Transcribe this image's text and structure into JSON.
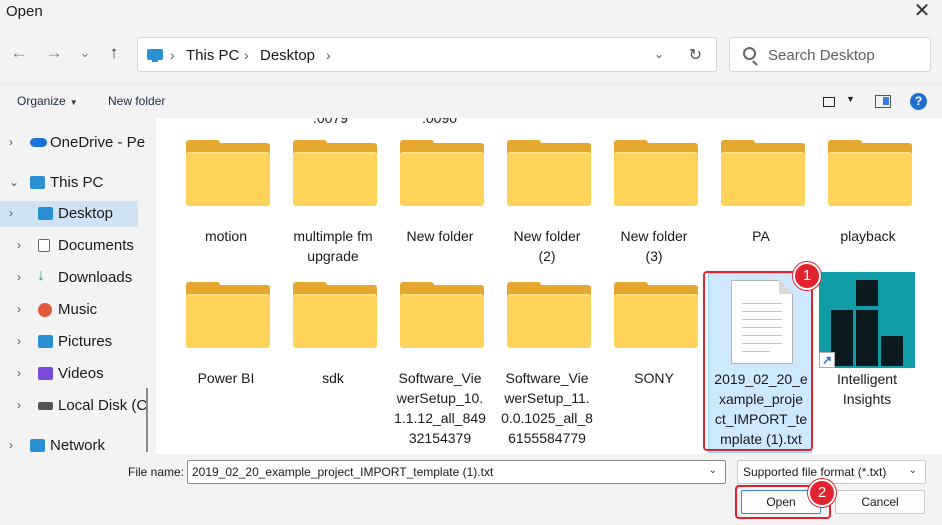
{
  "window": {
    "title": "Open"
  },
  "nav_buttons": {
    "back": "←",
    "forward": "→",
    "recent": "⌄",
    "up": "↑"
  },
  "address": {
    "crumbs": [
      "This PC",
      "Desktop"
    ],
    "separator": "›"
  },
  "search": {
    "placeholder": "Search Desktop"
  },
  "toolbar": {
    "organize": "Organize",
    "new_folder": "New folder"
  },
  "sidebar": {
    "items": [
      {
        "label": "OneDrive - Pe",
        "icon": "cloud-icon",
        "color": "#1a73d9"
      },
      {
        "label": "This PC",
        "icon": "computer-icon",
        "color": "#2b8fd4"
      },
      {
        "label": "Desktop",
        "icon": "desktop-icon",
        "color": "#2b8fd4",
        "selected": true
      },
      {
        "label": "Documents",
        "icon": "document-icon",
        "color": "#6a6a6a"
      },
      {
        "label": "Downloads",
        "icon": "download-icon",
        "color": "#1b9e5a"
      },
      {
        "label": "Music",
        "icon": "music-icon",
        "color": "#e05a3a"
      },
      {
        "label": "Pictures",
        "icon": "pictures-icon",
        "color": "#2b8fd4"
      },
      {
        "label": "Videos",
        "icon": "videos-icon",
        "color": "#7a4ad9"
      },
      {
        "label": "Local Disk (C",
        "icon": "disk-icon",
        "color": "#555555"
      },
      {
        "label": "Network",
        "icon": "network-icon",
        "color": "#2b8fd4"
      }
    ]
  },
  "files": {
    "partial_above": [
      ".0079",
      ".0090"
    ],
    "row1": [
      {
        "name": [
          "motion"
        ]
      },
      {
        "name": [
          "multimple fm",
          "upgrade"
        ]
      },
      {
        "name": [
          "New folder"
        ]
      },
      {
        "name": [
          "New folder",
          "(2)"
        ]
      },
      {
        "name": [
          "New folder",
          "(3)"
        ]
      },
      {
        "name": [
          "PA"
        ]
      },
      {
        "name": [
          "playback"
        ]
      }
    ],
    "row2": [
      {
        "name": [
          "Power BI"
        ]
      },
      {
        "name": [
          "sdk"
        ]
      },
      {
        "name": [
          "Software_Vie",
          "werSetup_10.",
          "1.1.12_all_849",
          "32154379"
        ]
      },
      {
        "name": [
          "Software_Vie",
          "werSetup_11.",
          "0.0.1025_all_8",
          "6155584779"
        ]
      },
      {
        "name": [
          "SONY"
        ]
      }
    ],
    "selected_file": {
      "name": [
        "2019_02_20_e",
        "xample_proje",
        "ct_IMPORT_te",
        "mplate (1).txt"
      ]
    },
    "app_shortcut": {
      "name": [
        "Intelligent",
        "Insights"
      ]
    }
  },
  "footer": {
    "file_name_label": "File name:",
    "file_name_value": "2019_02_20_example_project_IMPORT_template (1).txt",
    "file_type": "Supported file format (*.txt)",
    "open_label": "Open",
    "cancel_label": "Cancel"
  },
  "annotations": {
    "badge1": "1",
    "badge2": "2",
    "highlight_color": "#e2232f"
  }
}
